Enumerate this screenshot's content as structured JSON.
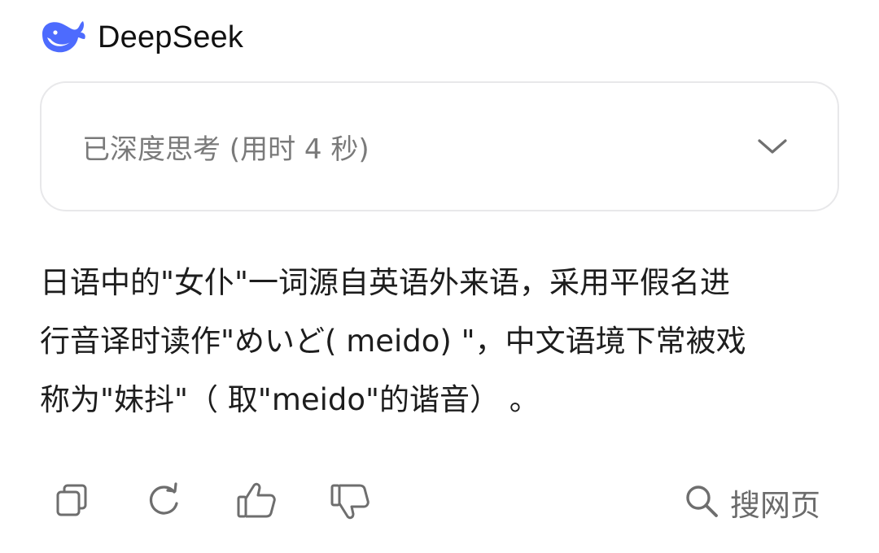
{
  "header": {
    "logo_icon": "deepseek-whale-icon",
    "brand_name": "DeepSeek",
    "brand_color": "#4D6BFE"
  },
  "thinking": {
    "label": "已深度思考 (用时 4 秒)",
    "toggle_icon": "chevron-down-icon"
  },
  "answer": {
    "lines": [
      "日语中的\"女仆\"一词源自英语外来语，采用平假名进",
      "行音译时读作\"めいど( meido) \"，中文语境下常被戏",
      "称为\"妹抖\"（ 取\"meido\"的谐音） 。"
    ]
  },
  "actions": {
    "copy_icon": "copy-icon",
    "regenerate_icon": "refresh-icon",
    "like_icon": "thumbs-up-icon",
    "dislike_icon": "thumbs-down-icon",
    "search_icon": "search-icon",
    "search_label": "搜网页"
  }
}
